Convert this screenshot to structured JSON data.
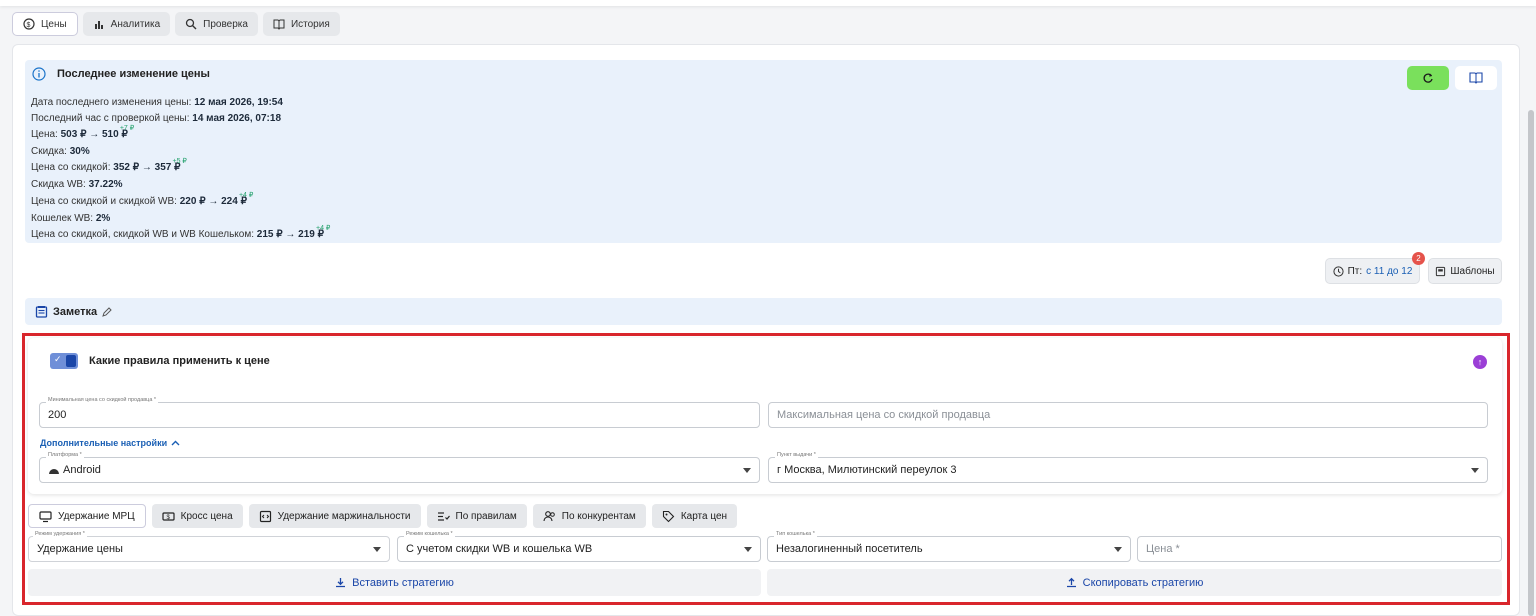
{
  "tabs": [
    {
      "label": "Цены",
      "icon": "price-icon",
      "active": true
    },
    {
      "label": "Аналитика",
      "icon": "bar-chart-icon",
      "active": false
    },
    {
      "label": "Проверка",
      "icon": "search-icon",
      "active": false
    },
    {
      "label": "История",
      "icon": "book-icon",
      "active": false
    }
  ],
  "info": {
    "title": "Последнее изменение цены",
    "lines": [
      {
        "label": "Дата последнего изменения цены: ",
        "value": "12 мая 2026, 19:54",
        "delta": ""
      },
      {
        "label": "Последний час с проверкой цены: ",
        "value": "14 мая 2026, 07:18",
        "delta": ""
      },
      {
        "label": "Цена: ",
        "value": "503 ₽ → 510 ₽",
        "delta": "+7 ₽"
      },
      {
        "label": "Скидка: ",
        "value": "30%",
        "delta": ""
      },
      {
        "label": "Цена со скидкой: ",
        "value": "352 ₽ → 357 ₽",
        "delta": "+5 ₽"
      },
      {
        "label": "Скидка WB: ",
        "value": "37.22%",
        "delta": ""
      },
      {
        "label": "Цена со скидкой и скидкой WB: ",
        "value": "220 ₽ → 224 ₽",
        "delta": "+4 ₽"
      },
      {
        "label": "Кошелек WB: ",
        "value": "2%",
        "delta": ""
      },
      {
        "label": "Цена со скидкой, скидкой WB и WB Кошельком: ",
        "value": "215 ₽ → 219 ₽",
        "delta": "+4 ₽"
      }
    ]
  },
  "schedule": {
    "prefix": "Пт: ",
    "range": "с 11 до 12",
    "badge": "2"
  },
  "templates_label": "Шаблоны",
  "note_label": "Заметка",
  "rules": {
    "title": "Какие правила применить к цене",
    "enabled": true,
    "min_price_label": "Минимальная цена со скидкой продавца *",
    "min_price_value": "200",
    "max_price_placeholder": "Максимальная цена со скидкой продавца",
    "advanced_label": "Дополнительные настройки",
    "platform_label": "Платформа *",
    "platform_value": "Android",
    "pickup_label": "Пункт выдачи *",
    "pickup_value": "г Москва, Милютинский переулок 3"
  },
  "strategy_tabs": [
    {
      "label": "Удержание МРЦ",
      "icon": "monitor-icon",
      "active": true
    },
    {
      "label": "Кросс цена",
      "icon": "cash-icon",
      "active": false
    },
    {
      "label": "Удержание маржинальности",
      "icon": "code-box-icon",
      "active": false
    },
    {
      "label": "По правилам",
      "icon": "list-check-icon",
      "active": false
    },
    {
      "label": "По конкурентам",
      "icon": "users-icon",
      "active": false
    },
    {
      "label": "Карта цен",
      "icon": "tag-icon",
      "active": false
    }
  ],
  "strategy": {
    "hold_mode_label": "Режим удержания *",
    "hold_mode_value": "Удержание цены",
    "wallet_mode_label": "Режим кошелька *",
    "wallet_mode_value": "С учетом скидки WB и кошелька WB",
    "wallet_type_label": "Тип кошелька *",
    "wallet_type_value": "Незалогиненный посетитель",
    "price_placeholder": "Цена *",
    "paste_label": "Вставить стратегию",
    "copy_label": "Скопировать стратегию"
  },
  "colors": {
    "accent": "#1a46a8",
    "green": "#7ae05c",
    "red_frame": "#d9262c",
    "info_bg": "#e9f1fb"
  }
}
